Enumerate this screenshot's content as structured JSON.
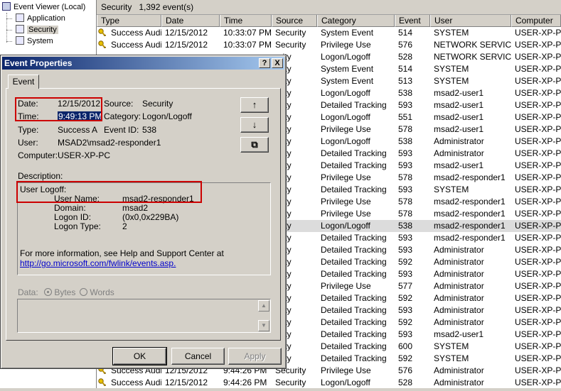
{
  "tree": {
    "root": "Event Viewer (Local)",
    "items": [
      "Application",
      "Security",
      "System"
    ]
  },
  "list": {
    "title": "Security",
    "count": "1,392 event(s)",
    "columns": [
      "Type",
      "Date",
      "Time",
      "Source",
      "Category",
      "Event",
      "User",
      "Computer"
    ],
    "rows": [
      [
        "Success Audit",
        "12/15/2012",
        "10:33:07 PM",
        "Security",
        "System Event",
        "514",
        "SYSTEM",
        "USER-XP-PC"
      ],
      [
        "Success Audit",
        "12/15/2012",
        "10:33:07 PM",
        "Security",
        "Privilege Use",
        "576",
        "NETWORK SERVICE",
        "USER-XP-PC"
      ],
      [
        "",
        "",
        "",
        "urity",
        "Logon/Logoff",
        "528",
        "NETWORK SERVICE",
        "USER-XP-PC"
      ],
      [
        "",
        "",
        "",
        "urity",
        "System Event",
        "514",
        "SYSTEM",
        "USER-XP-PC"
      ],
      [
        "",
        "",
        "",
        "urity",
        "System Event",
        "513",
        "SYSTEM",
        "USER-XP-PC"
      ],
      [
        "",
        "",
        "",
        "urity",
        "Logon/Logoff",
        "538",
        "msad2-user1",
        "USER-XP-PC"
      ],
      [
        "",
        "",
        "",
        "urity",
        "Detailed Tracking",
        "593",
        "msad2-user1",
        "USER-XP-PC"
      ],
      [
        "",
        "",
        "",
        "urity",
        "Logon/Logoff",
        "551",
        "msad2-user1",
        "USER-XP-PC"
      ],
      [
        "",
        "",
        "",
        "urity",
        "Privilege Use",
        "578",
        "msad2-user1",
        "USER-XP-PC"
      ],
      [
        "",
        "",
        "",
        "urity",
        "Logon/Logoff",
        "538",
        "Administrator",
        "USER-XP-PC"
      ],
      [
        "",
        "",
        "",
        "urity",
        "Detailed Tracking",
        "593",
        "Administrator",
        "USER-XP-PC"
      ],
      [
        "",
        "",
        "",
        "urity",
        "Detailed Tracking",
        "593",
        "msad2-user1",
        "USER-XP-PC"
      ],
      [
        "",
        "",
        "",
        "urity",
        "Privilege Use",
        "578",
        "msad2-responder1",
        "USER-XP-PC"
      ],
      [
        "",
        "",
        "",
        "urity",
        "Detailed Tracking",
        "593",
        "SYSTEM",
        "USER-XP-PC"
      ],
      [
        "",
        "",
        "",
        "urity",
        "Privilege Use",
        "578",
        "msad2-responder1",
        "USER-XP-PC"
      ],
      [
        "",
        "",
        "",
        "urity",
        "Privilege Use",
        "578",
        "msad2-responder1",
        "USER-XP-PC"
      ],
      [
        "",
        "",
        "",
        "urity",
        "Logon/Logoff",
        "538",
        "msad2-responder1",
        "USER-XP-PC"
      ],
      [
        "",
        "",
        "",
        "urity",
        "Detailed Tracking",
        "593",
        "msad2-responder1",
        "USER-XP-PC"
      ],
      [
        "",
        "",
        "",
        "urity",
        "Detailed Tracking",
        "593",
        "Administrator",
        "USER-XP-PC"
      ],
      [
        "",
        "",
        "",
        "urity",
        "Detailed Tracking",
        "592",
        "Administrator",
        "USER-XP-PC"
      ],
      [
        "",
        "",
        "",
        "urity",
        "Detailed Tracking",
        "593",
        "Administrator",
        "USER-XP-PC"
      ],
      [
        "",
        "",
        "",
        "urity",
        "Privilege Use",
        "577",
        "Administrator",
        "USER-XP-PC"
      ],
      [
        "",
        "",
        "",
        "urity",
        "Detailed Tracking",
        "592",
        "Administrator",
        "USER-XP-PC"
      ],
      [
        "",
        "",
        "",
        "urity",
        "Detailed Tracking",
        "593",
        "Administrator",
        "USER-XP-PC"
      ],
      [
        "",
        "",
        "",
        "urity",
        "Detailed Tracking",
        "592",
        "Administrator",
        "USER-XP-PC"
      ],
      [
        "",
        "",
        "",
        "urity",
        "Detailed Tracking",
        "593",
        "msad2-user1",
        "USER-XP-PC"
      ],
      [
        "",
        "",
        "",
        "urity",
        "Detailed Tracking",
        "600",
        "SYSTEM",
        "USER-XP-PC"
      ],
      [
        "",
        "",
        "",
        "urity",
        "Detailed Tracking",
        "592",
        "SYSTEM",
        "USER-XP-PC"
      ],
      [
        "Success Audit",
        "12/15/2012",
        "9:44:26 PM",
        "Security",
        "Privilege Use",
        "576",
        "Administrator",
        "USER-XP-PC"
      ],
      [
        "Success Audit",
        "12/15/2012",
        "9:44:26 PM",
        "Security",
        "Logon/Logoff",
        "528",
        "Administrator",
        "USER-XP-PC"
      ]
    ],
    "highlighted_row": 16
  },
  "dialog": {
    "title": "Event Properties",
    "help_btn": "?",
    "close_btn": "X",
    "tab": "Event",
    "date_label": "Date:",
    "date_value": "12/15/2012",
    "source_label": "Source:",
    "source_value": "Security",
    "time_label": "Time:",
    "time_value": "9:49:13 PM",
    "category_label": "Category:",
    "category_value": "Logon/Logoff",
    "type_label": "Type:",
    "type_value": "Success A",
    "eventid_label": "Event ID:",
    "eventid_value": "538",
    "user_label": "User:",
    "user_value": "MSAD2\\msad2-responder1",
    "computer_label": "Computer:",
    "computer_value": "USER-XP-PC",
    "description_label": "Description:",
    "desc_heading": "User Logoff:",
    "desc_fields": [
      {
        "label": "User Name:",
        "value": "msad2-responder1"
      },
      {
        "label": "Domain:",
        "value": "msad2"
      },
      {
        "label": "Logon ID:",
        "value": "(0x0,0x229BA)"
      },
      {
        "label": "Logon Type:",
        "value": "2"
      }
    ],
    "help_text": "For more information, see Help and Support Center at",
    "help_link": "http://go.microsoft.com/fwlink/events.asp.",
    "data_label": "Data:",
    "bytes_label": "Bytes",
    "words_label": "Words",
    "ok": "OK",
    "cancel": "Cancel",
    "apply": "Apply",
    "up_arrow": "↑",
    "down_arrow": "↓",
    "copy_icon": "⧉"
  },
  "colors": {
    "titlebar": "#0a246a",
    "highlight_box": "#cc0000",
    "link": "#0000cc"
  }
}
